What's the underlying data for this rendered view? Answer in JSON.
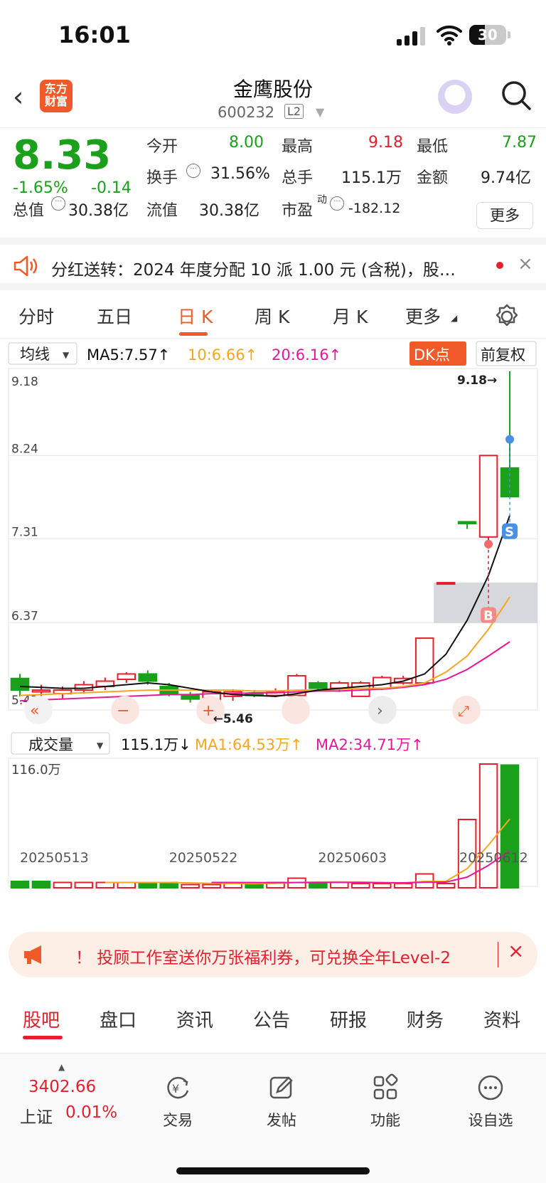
{
  "status": {
    "time": "16:01",
    "battery": "30"
  },
  "header": {
    "title": "金鹰股份",
    "code": "600232",
    "level": "L2",
    "logo": "东方\n财富"
  },
  "quote": {
    "price": "8.33",
    "change_pct": "-1.65%",
    "change": "-0.14",
    "open_label": "今开",
    "open": "8.00",
    "high_label": "最高",
    "high": "9.18",
    "low_label": "最低",
    "low": "7.87",
    "turnover_label": "换手",
    "turnover": "31.56%",
    "volume_label": "总手",
    "volume": "115.1万",
    "amount_label": "金额",
    "amount": "9.74亿",
    "mktcap_label": "总值",
    "mktcap": "30.38亿",
    "float_label": "流值",
    "float_cap": "30.38亿",
    "pe_label": "市盈",
    "pe_sup": "动",
    "pe": "-182.12",
    "more_label": "更多"
  },
  "notice": {
    "text": "分红送转：2024 年度分配 10 派 1.00 元 (含税)，股…"
  },
  "tabs": [
    "分时",
    "五日",
    "日 K",
    "周 K",
    "月 K",
    "更多"
  ],
  "chart": {
    "ma_select": "均线",
    "ma5": "MA5:7.57↑",
    "ma10": "10:6.66↑",
    "ma20": "20:6.16↑",
    "dk_label": "DK点",
    "adjust_label": "前复权",
    "y_ticks": [
      "9.18",
      "8.24",
      "7.31",
      "6.37",
      "5.43"
    ],
    "high_marker": "9.18→",
    "low_marker": "←5.46",
    "buy_label": "B",
    "sell_label": "S",
    "vol_select": "成交量",
    "vol_value": "115.1万↓",
    "vol_ma1": "MA1:64.53万↑",
    "vol_ma2": "MA2:34.71万↑",
    "vol_max": "116.0万",
    "dates": [
      "20250513",
      "20250522",
      "20250603",
      "20250612"
    ],
    "colors": {
      "ma5": "#111111",
      "ma10": "#f5a623",
      "ma20": "#e5199b",
      "up": "#e5202e",
      "down": "#1aa01a"
    }
  },
  "chart_data": {
    "type": "candlestick",
    "y_range": [
      5.43,
      9.18
    ],
    "candles": [
      {
        "o": 5.75,
        "c": 5.62,
        "h": 5.8,
        "l": 5.55
      },
      {
        "o": 5.6,
        "c": 5.62,
        "h": 5.68,
        "l": 5.55
      },
      {
        "o": 5.58,
        "c": 5.62,
        "h": 5.66,
        "l": 5.52
      },
      {
        "o": 5.62,
        "c": 5.68,
        "h": 5.72,
        "l": 5.58
      },
      {
        "o": 5.66,
        "c": 5.72,
        "h": 5.76,
        "l": 5.62
      },
      {
        "o": 5.74,
        "c": 5.8,
        "h": 5.82,
        "l": 5.7
      },
      {
        "o": 5.8,
        "c": 5.72,
        "h": 5.84,
        "l": 5.68
      },
      {
        "o": 5.66,
        "c": 5.58,
        "h": 5.7,
        "l": 5.55
      },
      {
        "o": 5.56,
        "c": 5.52,
        "h": 5.6,
        "l": 5.48
      },
      {
        "o": 5.5,
        "c": 5.6,
        "h": 5.62,
        "l": 5.46
      },
      {
        "o": 5.55,
        "c": 5.6,
        "h": 5.63,
        "l": 5.5
      },
      {
        "o": 5.58,
        "c": 5.56,
        "h": 5.62,
        "l": 5.54
      },
      {
        "o": 5.56,
        "c": 5.6,
        "h": 5.64,
        "l": 5.54
      },
      {
        "o": 5.56,
        "c": 5.78,
        "h": 5.8,
        "l": 5.55
      },
      {
        "o": 5.7,
        "c": 5.64,
        "h": 5.72,
        "l": 5.62
      },
      {
        "o": 5.64,
        "c": 5.7,
        "h": 5.72,
        "l": 5.6
      },
      {
        "o": 5.55,
        "c": 5.7,
        "h": 5.72,
        "l": 5.55
      },
      {
        "o": 5.64,
        "c": 5.76,
        "h": 5.78,
        "l": 5.62
      },
      {
        "o": 5.7,
        "c": 5.75,
        "h": 5.78,
        "l": 5.68
      },
      {
        "o": 5.7,
        "c": 6.2,
        "h": 6.2,
        "l": 5.68
      },
      {
        "o": 6.82,
        "c": 6.82,
        "h": 6.82,
        "l": 6.82
      },
      {
        "o": 7.5,
        "c": 7.48,
        "h": 7.5,
        "l": 7.42
      },
      {
        "o": 7.33,
        "c": 8.24,
        "h": 8.24,
        "l": 7.2
      },
      {
        "o": 8.1,
        "c": 7.78,
        "h": 9.18,
        "l": 7.87
      }
    ],
    "volume": [
      6,
      6,
      5,
      5,
      5,
      5,
      5,
      5,
      3,
      3,
      4,
      4,
      5,
      9,
      5,
      5,
      4,
      4,
      4,
      13,
      4,
      64,
      116,
      115
    ],
    "volume_up": [
      false,
      false,
      true,
      true,
      true,
      true,
      false,
      false,
      true,
      true,
      true,
      false,
      true,
      true,
      false,
      true,
      true,
      true,
      true,
      true,
      true,
      true,
      true,
      false
    ],
    "ma5": [
      5.66,
      5.65,
      5.64,
      5.64,
      5.66,
      5.68,
      5.7,
      5.68,
      5.64,
      5.6,
      5.57,
      5.56,
      5.55,
      5.58,
      5.62,
      5.64,
      5.66,
      5.68,
      5.72,
      5.8,
      6.02,
      6.4,
      6.9,
      7.57
    ],
    "ma10": [
      5.56,
      5.57,
      5.58,
      5.59,
      5.6,
      5.61,
      5.62,
      5.62,
      5.62,
      5.62,
      5.62,
      5.61,
      5.61,
      5.62,
      5.62,
      5.63,
      5.64,
      5.64,
      5.66,
      5.7,
      5.82,
      6.0,
      6.3,
      6.66
    ],
    "ma20": [
      5.5,
      5.51,
      5.52,
      5.53,
      5.54,
      5.55,
      5.56,
      5.57,
      5.57,
      5.58,
      5.58,
      5.59,
      5.59,
      5.6,
      5.61,
      5.61,
      5.62,
      5.63,
      5.65,
      5.68,
      5.74,
      5.85,
      6.0,
      6.16
    ],
    "vol_ma1": [
      null,
      null,
      null,
      null,
      5,
      5,
      5,
      5,
      4.6,
      4.2,
      4,
      3.8,
      4.2,
      5,
      5.4,
      5.6,
      5.4,
      4.8,
      4.4,
      6,
      6,
      18,
      40,
      64.53
    ],
    "vol_ma2": [
      null,
      null,
      null,
      null,
      null,
      null,
      null,
      null,
      null,
      5,
      5,
      4.9,
      4.8,
      4.9,
      5,
      5,
      4.9,
      4.8,
      4.7,
      5.2,
      5.3,
      10,
      21,
      34.71
    ]
  },
  "ad": {
    "text": "！ 投顾工作室送你万张福利券，可兑换全年Level-2"
  },
  "bottom_tabs": [
    "股吧",
    "盘口",
    "资讯",
    "公告",
    "研报",
    "财务",
    "资料"
  ],
  "bottom_bar": {
    "index_value": "3402.66",
    "index_name": "上证",
    "index_change": "0.01%",
    "nav": [
      "交易",
      "发帖",
      "功能",
      "设自选"
    ]
  }
}
